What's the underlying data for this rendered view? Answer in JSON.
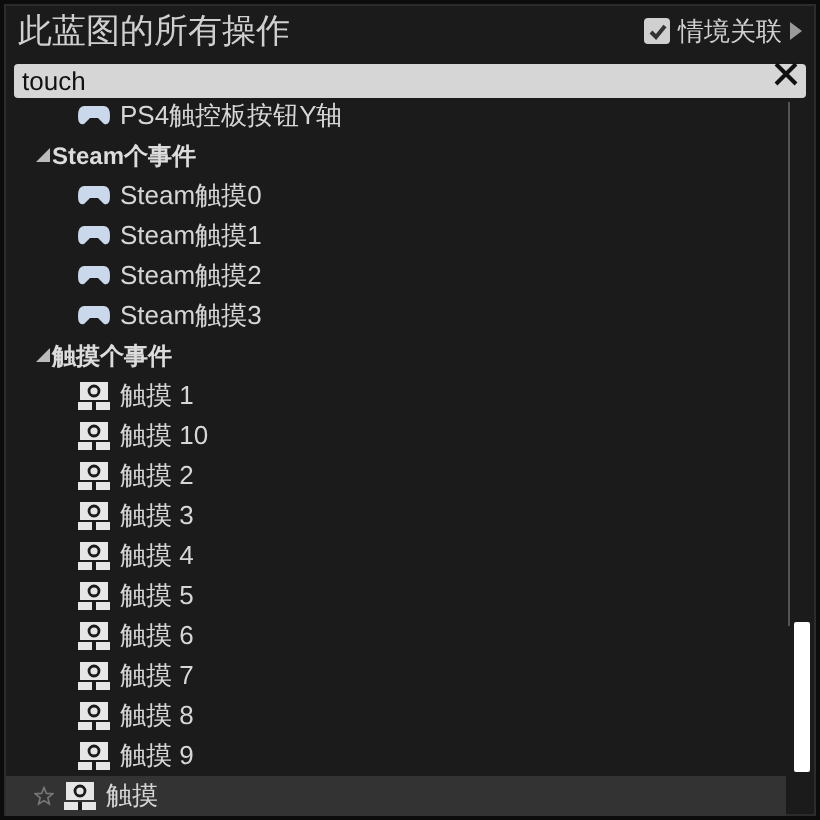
{
  "header": {
    "title": "此蓝图的所有操作",
    "context_toggle": {
      "label": "情境关联",
      "checked": true
    }
  },
  "search": {
    "value": "touch"
  },
  "tree": {
    "continued_items": [
      {
        "kind": "gamepad",
        "label": "PS4触控板按钮Y轴",
        "highlighted": false
      }
    ],
    "nodes": [
      {
        "kind": "category",
        "label": "Steam个事件",
        "expanded": true,
        "children": [
          {
            "kind": "gamepad",
            "label": "Steam触摸0",
            "highlighted": false
          },
          {
            "kind": "gamepad",
            "label": "Steam触摸1",
            "highlighted": false
          },
          {
            "kind": "gamepad",
            "label": "Steam触摸2",
            "highlighted": false
          },
          {
            "kind": "gamepad",
            "label": "Steam触摸3",
            "highlighted": false
          }
        ]
      },
      {
        "kind": "category",
        "label": "触摸个事件",
        "expanded": true,
        "children": [
          {
            "kind": "touch",
            "label": "触摸 1",
            "highlighted": false
          },
          {
            "kind": "touch",
            "label": "触摸 10",
            "highlighted": false
          },
          {
            "kind": "touch",
            "label": "触摸 2",
            "highlighted": false
          },
          {
            "kind": "touch",
            "label": "触摸 3",
            "highlighted": false
          },
          {
            "kind": "touch",
            "label": "触摸 4",
            "highlighted": false
          },
          {
            "kind": "touch",
            "label": "触摸 5",
            "highlighted": false
          },
          {
            "kind": "touch",
            "label": "触摸 6",
            "highlighted": false
          },
          {
            "kind": "touch",
            "label": "触摸 7",
            "highlighted": false
          },
          {
            "kind": "touch",
            "label": "触摸 8",
            "highlighted": false
          },
          {
            "kind": "touch",
            "label": "触摸 9",
            "highlighted": false
          }
        ]
      },
      {
        "kind": "touch",
        "label": "触摸",
        "highlighted": true
      }
    ]
  }
}
